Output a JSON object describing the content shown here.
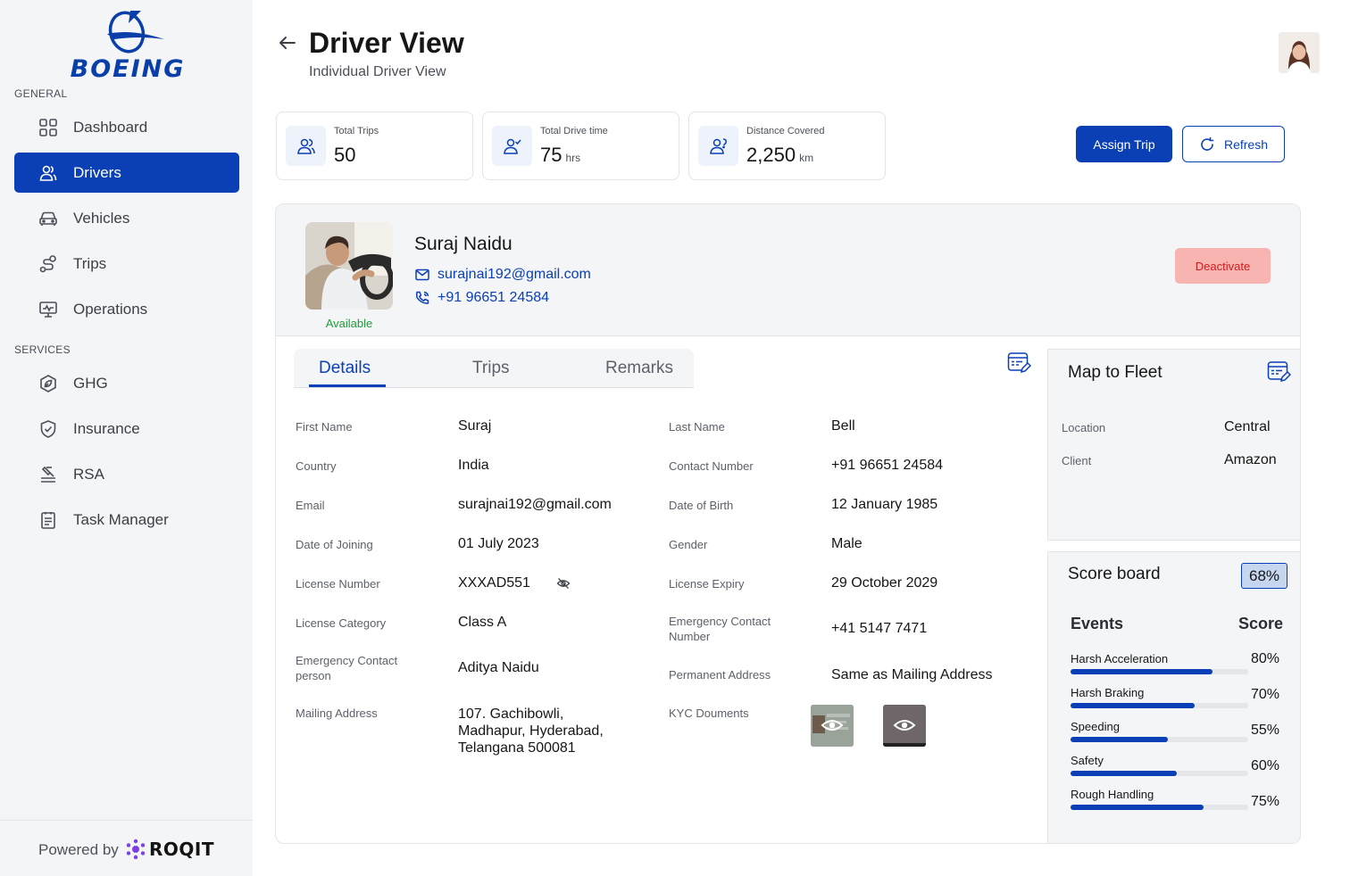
{
  "brand": {
    "logo_text": "BOEING",
    "accent": "#0a3fb5"
  },
  "sidebar": {
    "general_label": "GENERAL",
    "services_label": "SERVICES",
    "items": [
      {
        "label": "Dashboard",
        "icon": "grid-icon"
      },
      {
        "label": "Drivers",
        "icon": "users-icon",
        "active": true
      },
      {
        "label": "Vehicles",
        "icon": "car-icon"
      },
      {
        "label": "Trips",
        "icon": "route-icon"
      },
      {
        "label": "Operations",
        "icon": "monitor-icon"
      },
      {
        "label": "GHG",
        "icon": "leaf-icon"
      },
      {
        "label": "Insurance",
        "icon": "shield-check-icon"
      },
      {
        "label": "RSA",
        "icon": "roadside-assist-icon"
      },
      {
        "label": "Task Manager",
        "icon": "task-list-icon"
      }
    ],
    "footer": {
      "powered_by": "Powered by",
      "partner": "ROQIT"
    }
  },
  "header": {
    "title": "Driver View",
    "subtitle": "Individual Driver View"
  },
  "stats": [
    {
      "label": "Total Trips",
      "value": "50",
      "unit": ""
    },
    {
      "label": "Total Drive time",
      "value": "75",
      "unit": "hrs"
    },
    {
      "label": "Distance Covered",
      "value": "2,250",
      "unit": "km"
    }
  ],
  "actions": {
    "assign_trip": "Assign Trip",
    "refresh": "Refresh",
    "deactivate": "Deactivate"
  },
  "driver": {
    "name": "Suraj Naidu",
    "email": "surajnai192@gmail.com",
    "phone": "+91 96651 24584",
    "status": "Available"
  },
  "tabs": [
    "Details",
    "Trips",
    "Remarks"
  ],
  "details": {
    "left": [
      {
        "label": "First Name",
        "value": "Suraj"
      },
      {
        "label": "Country",
        "value": "India"
      },
      {
        "label": "Email",
        "value": "surajnai192@gmail.com"
      },
      {
        "label": "Date of Joining",
        "value": "01 July 2023"
      },
      {
        "label": "License Number",
        "value": "XXXAD551"
      },
      {
        "label": "License Category",
        "value": "Class A"
      },
      {
        "label": "Emergency Contact person",
        "value": "Aditya Naidu"
      },
      {
        "label": "Mailing Address",
        "value": "107. Gachibowli, Madhapur, Hyderabad, Telangana 500081"
      }
    ],
    "right": [
      {
        "label": "Last Name",
        "value": "Bell"
      },
      {
        "label": "Contact Number",
        "value": "+91 96651 24584"
      },
      {
        "label": "Date of Birth",
        "value": "12 January 1985"
      },
      {
        "label": "Gender",
        "value": "Male"
      },
      {
        "label": "License Expiry",
        "value": "29 October 2029"
      },
      {
        "label": "Emergency Contact Number",
        "value": "+41 5147 7471"
      },
      {
        "label": "Permanent Address",
        "value": "Same as Mailing Address"
      },
      {
        "label": "KYC Douments",
        "value": ""
      }
    ]
  },
  "fleet": {
    "title": "Map to Fleet",
    "rows": [
      {
        "label": "Location",
        "value": "Central"
      },
      {
        "label": "Client",
        "value": "Amazon"
      }
    ]
  },
  "scoreboard": {
    "title": "Score board",
    "overall": "68%",
    "events_header": "Events",
    "score_header": "Score",
    "events": [
      {
        "name": "Harsh Acceleration",
        "score": "80%",
        "value": 80
      },
      {
        "name": "Harsh Braking",
        "score": "70%",
        "value": 70
      },
      {
        "name": "Speeding",
        "score": "55%",
        "value": 55
      },
      {
        "name": "Safety",
        "score": "60%",
        "value": 60
      },
      {
        "name": "Rough Handling",
        "score": "75%",
        "value": 75
      }
    ]
  }
}
